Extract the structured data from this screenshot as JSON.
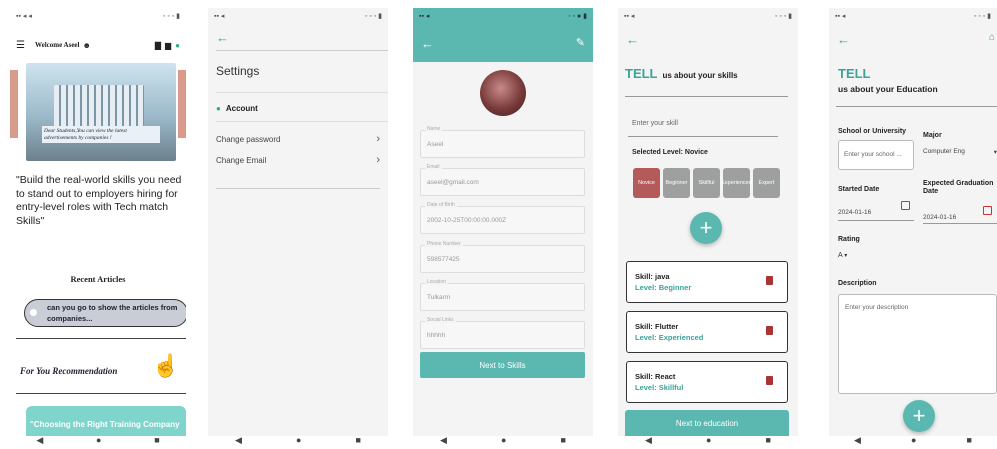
{
  "nav": {
    "back": "◀",
    "home": "●",
    "recents": "■",
    "arrow": "←"
  },
  "home": {
    "welcome": "Welcome Aseel",
    "banner_text": "Dear Students,You can view the latest advertisements by companies !",
    "quote": "\"Build the real-world skills you need to stand out to employers hiring for entry-level roles with Tech match Skills\"",
    "recent_articles": "Recent Articles",
    "article_chip": "can you go to show the articles from companies...",
    "for_you": "For You Recommendation",
    "teaser": "\"Choosing the Right Training Company"
  },
  "settings": {
    "title": "Settings",
    "section": "Account",
    "items": [
      "Change password",
      "Change Email"
    ]
  },
  "profile": {
    "fields": [
      {
        "label": "Name",
        "value": "Aseel"
      },
      {
        "label": "Email",
        "value": "aseel@gmail.com"
      },
      {
        "label": "Date of Birth",
        "value": "2002-10-25T00:00:00.000Z"
      },
      {
        "label": "Phone Number",
        "value": "598577425"
      },
      {
        "label": "Location",
        "value": "Tulkarm"
      },
      {
        "label": "Social Links",
        "value": "hhhhh"
      }
    ],
    "next": "Next to Skills"
  },
  "skills": {
    "tell": "TELL",
    "heading": "us about your skills",
    "placeholder": "Enter your skill",
    "selected_level": "Selected Level: Novice",
    "levels": [
      "Novice",
      "Beginner",
      "Skillful",
      "Experienced",
      "Expert"
    ],
    "cards": [
      {
        "skill": "Skill: java",
        "level": "Level: Beginner"
      },
      {
        "skill": "Skill: Flutter",
        "level": "Level: Experienced"
      },
      {
        "skill": "Skill: React",
        "level": "Level: Skillful"
      }
    ],
    "next": "Next to education"
  },
  "education": {
    "tell": "TELL",
    "heading": "us about your Education",
    "school_label": "School or University",
    "school_placeholder": "Enter your school ...",
    "major_label": "Major",
    "major_value": "Computer Eng",
    "started_label": "Started Date",
    "started_value": "2024-01-16",
    "grad_label": "Expected Graduation Date",
    "grad_value": "2024-01-16",
    "rating_label": "Rating",
    "rating_value": "A",
    "description_label": "Description",
    "description_placeholder": "Enter your description"
  },
  "colors": {
    "teal": "#5bb8b0",
    "selected_level": "#b55a5a",
    "level": "#9ea09f"
  }
}
